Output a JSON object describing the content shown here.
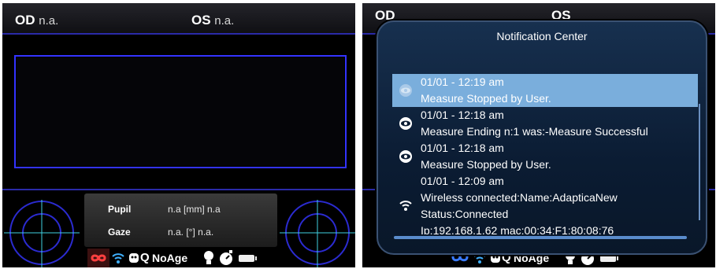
{
  "left_screen": {
    "od_label": "OD",
    "od_value": "n.a.",
    "os_label": "OS",
    "os_value": "n.a.",
    "pupil_label": "Pupil",
    "pupil_value": "n.a [mm] n.a",
    "gaze_label": "Gaze",
    "gaze_value": "n.a. [°] n.a.",
    "status": {
      "q_label": "Q",
      "age_label": "NoAge"
    }
  },
  "right_screen": {
    "status": {
      "q_label": "Q",
      "age_label": "NoAge"
    },
    "notification_center": {
      "title": "Notification Center",
      "items": [
        {
          "lines": [
            "01/01 - 12:19 am",
            "Measure Stopped by User."
          ],
          "icon": "eye-icon",
          "selected": true
        },
        {
          "lines": [
            "01/01 - 12:18 am",
            "Measure Ending n:1 was:-Measure Successful"
          ],
          "icon": "eye-icon",
          "selected": false
        },
        {
          "lines": [
            "01/01 - 12:18 am",
            "Measure Stopped by User."
          ],
          "icon": "eye-icon",
          "selected": false
        },
        {
          "lines": [
            "01/01 - 12:09 am",
            "Wireless connected:Name:AdapticaNew",
            "Status:Connected",
            "Ip:192.168.1.62 mac:00:34:F1:80:08:76"
          ],
          "icon": "wifi-icon",
          "selected": false
        }
      ]
    }
  },
  "colors": {
    "frame_blue": "#3333ff",
    "panel_bg": "#0b1c33",
    "selection": "#7aaedc"
  }
}
